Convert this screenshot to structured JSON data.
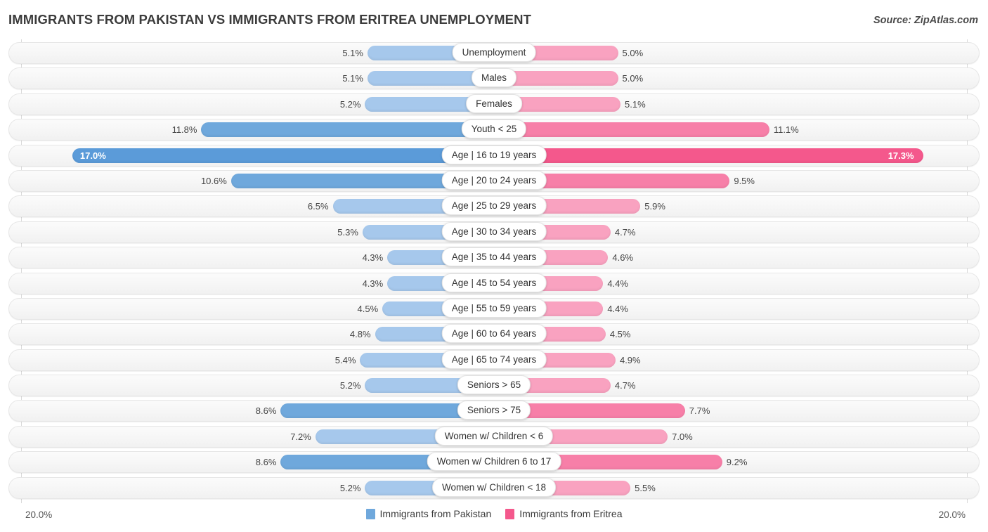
{
  "header": {
    "title": "IMMIGRANTS FROM PAKISTAN VS IMMIGRANTS FROM ERITREA UNEMPLOYMENT",
    "source": "Source: ZipAtlas.com"
  },
  "legend": {
    "items": [
      {
        "label": "Immigrants from Pakistan",
        "color": "#6fa8dc"
      },
      {
        "label": "Immigrants from Eritrea",
        "color": "#f4588c"
      }
    ]
  },
  "axis": {
    "min_label": "20.0%",
    "max_label": "20.0%",
    "max_value": 20.0
  },
  "colors": {
    "blue_light": "#a6c8ec",
    "blue_medium": "#6fa8dc",
    "blue_dark": "#5b9bd9",
    "pink_light": "#f9a2c0",
    "pink_medium": "#f77fa8",
    "pink_dark": "#f4588c"
  },
  "chart_data": {
    "type": "bar",
    "orientation": "horizontal-diverging",
    "title": "IMMIGRANTS FROM PAKISTAN VS IMMIGRANTS FROM ERITREA UNEMPLOYMENT",
    "xlabel": "",
    "ylabel": "",
    "xlim": [
      20.0,
      20.0
    ],
    "grid": true,
    "legend_position": "bottom-center",
    "categories": [
      "Unemployment",
      "Males",
      "Females",
      "Youth < 25",
      "Age | 16 to 19 years",
      "Age | 20 to 24 years",
      "Age | 25 to 29 years",
      "Age | 30 to 34 years",
      "Age | 35 to 44 years",
      "Age | 45 to 54 years",
      "Age | 55 to 59 years",
      "Age | 60 to 64 years",
      "Age | 65 to 74 years",
      "Seniors > 65",
      "Seniors > 75",
      "Women w/ Children < 6",
      "Women w/ Children 6 to 17",
      "Women w/ Children < 18"
    ],
    "series": [
      {
        "name": "Immigrants from Pakistan",
        "values": [
          5.1,
          5.1,
          5.2,
          11.8,
          17.0,
          10.6,
          6.5,
          5.3,
          4.3,
          4.3,
          4.5,
          4.8,
          5.4,
          5.2,
          8.6,
          7.2,
          8.6,
          5.2
        ]
      },
      {
        "name": "Immigrants from Eritrea",
        "values": [
          5.0,
          5.0,
          5.1,
          11.1,
          17.3,
          9.5,
          5.9,
          4.7,
          4.6,
          4.4,
          4.4,
          4.5,
          4.9,
          4.7,
          7.7,
          7.0,
          9.2,
          5.5
        ]
      }
    ]
  },
  "rows": [
    {
      "label": "Unemployment",
      "left_value": 5.1,
      "right_value": 5.0,
      "left_text": "5.1%",
      "right_text": "5.0%",
      "left_color": "#a6c8ec",
      "right_color": "#f9a2c0",
      "labels_inside": false
    },
    {
      "label": "Males",
      "left_value": 5.1,
      "right_value": 5.0,
      "left_text": "5.1%",
      "right_text": "5.0%",
      "left_color": "#a6c8ec",
      "right_color": "#f9a2c0",
      "labels_inside": false
    },
    {
      "label": "Females",
      "left_value": 5.2,
      "right_value": 5.1,
      "left_text": "5.2%",
      "right_text": "5.1%",
      "left_color": "#a6c8ec",
      "right_color": "#f9a2c0",
      "labels_inside": false
    },
    {
      "label": "Youth < 25",
      "left_value": 11.8,
      "right_value": 11.1,
      "left_text": "11.8%",
      "right_text": "11.1%",
      "left_color": "#6fa8dc",
      "right_color": "#f77fa8",
      "labels_inside": false
    },
    {
      "label": "Age | 16 to 19 years",
      "left_value": 17.0,
      "right_value": 17.3,
      "left_text": "17.0%",
      "right_text": "17.3%",
      "left_color": "#5b9bd9",
      "right_color": "#f4588c",
      "labels_inside": true
    },
    {
      "label": "Age | 20 to 24 years",
      "left_value": 10.6,
      "right_value": 9.5,
      "left_text": "10.6%",
      "right_text": "9.5%",
      "left_color": "#6fa8dc",
      "right_color": "#f77fa8",
      "labels_inside": false
    },
    {
      "label": "Age | 25 to 29 years",
      "left_value": 6.5,
      "right_value": 5.9,
      "left_text": "6.5%",
      "right_text": "5.9%",
      "left_color": "#a6c8ec",
      "right_color": "#f9a2c0",
      "labels_inside": false
    },
    {
      "label": "Age | 30 to 34 years",
      "left_value": 5.3,
      "right_value": 4.7,
      "left_text": "5.3%",
      "right_text": "4.7%",
      "left_color": "#a6c8ec",
      "right_color": "#f9a2c0",
      "labels_inside": false
    },
    {
      "label": "Age | 35 to 44 years",
      "left_value": 4.3,
      "right_value": 4.6,
      "left_text": "4.3%",
      "right_text": "4.6%",
      "left_color": "#a6c8ec",
      "right_color": "#f9a2c0",
      "labels_inside": false
    },
    {
      "label": "Age | 45 to 54 years",
      "left_value": 4.3,
      "right_value": 4.4,
      "left_text": "4.3%",
      "right_text": "4.4%",
      "left_color": "#a6c8ec",
      "right_color": "#f9a2c0",
      "labels_inside": false
    },
    {
      "label": "Age | 55 to 59 years",
      "left_value": 4.5,
      "right_value": 4.4,
      "left_text": "4.5%",
      "right_text": "4.4%",
      "left_color": "#a6c8ec",
      "right_color": "#f9a2c0",
      "labels_inside": false
    },
    {
      "label": "Age | 60 to 64 years",
      "left_value": 4.8,
      "right_value": 4.5,
      "left_text": "4.8%",
      "right_text": "4.5%",
      "left_color": "#a6c8ec",
      "right_color": "#f9a2c0",
      "labels_inside": false
    },
    {
      "label": "Age | 65 to 74 years",
      "left_value": 5.4,
      "right_value": 4.9,
      "left_text": "5.4%",
      "right_text": "4.9%",
      "left_color": "#a6c8ec",
      "right_color": "#f9a2c0",
      "labels_inside": false
    },
    {
      "label": "Seniors > 65",
      "left_value": 5.2,
      "right_value": 4.7,
      "left_text": "5.2%",
      "right_text": "4.7%",
      "left_color": "#a6c8ec",
      "right_color": "#f9a2c0",
      "labels_inside": false
    },
    {
      "label": "Seniors > 75",
      "left_value": 8.6,
      "right_value": 7.7,
      "left_text": "8.6%",
      "right_text": "7.7%",
      "left_color": "#6fa8dc",
      "right_color": "#f77fa8",
      "labels_inside": false
    },
    {
      "label": "Women w/ Children < 6",
      "left_value": 7.2,
      "right_value": 7.0,
      "left_text": "7.2%",
      "right_text": "7.0%",
      "left_color": "#a6c8ec",
      "right_color": "#f9a2c0",
      "labels_inside": false
    },
    {
      "label": "Women w/ Children 6 to 17",
      "left_value": 8.6,
      "right_value": 9.2,
      "left_text": "8.6%",
      "right_text": "9.2%",
      "left_color": "#6fa8dc",
      "right_color": "#f77fa8",
      "labels_inside": false
    },
    {
      "label": "Women w/ Children < 18",
      "left_value": 5.2,
      "right_value": 5.5,
      "left_text": "5.2%",
      "right_text": "5.5%",
      "left_color": "#a6c8ec",
      "right_color": "#f9a2c0",
      "labels_inside": false
    }
  ]
}
